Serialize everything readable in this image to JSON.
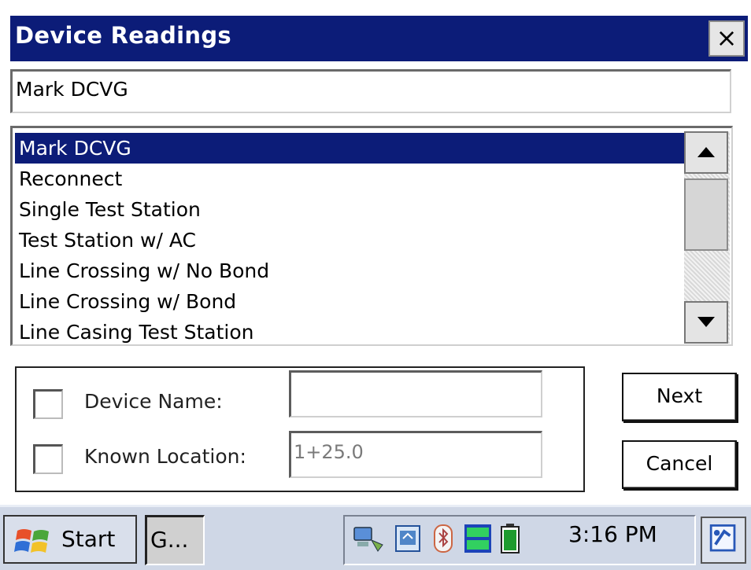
{
  "window": {
    "title": "Device Readings",
    "close_label": "×"
  },
  "combo": {
    "value": "Mark DCVG"
  },
  "list": {
    "items": [
      {
        "label": "Mark DCVG",
        "selected": true
      },
      {
        "label": "Reconnect"
      },
      {
        "label": "Single Test Station"
      },
      {
        "label": "Test Station w/ AC"
      },
      {
        "label": "Line Crossing w/ No Bond"
      },
      {
        "label": "Line Crossing w/ Bond"
      },
      {
        "label": "Line Casing Test Station"
      }
    ]
  },
  "options": {
    "device_name_label": "Device Name:",
    "device_name_value": "",
    "known_location_label": "Known Location:",
    "known_location_value": "1+25.0"
  },
  "buttons": {
    "next": "Next",
    "cancel": "Cancel"
  },
  "taskbar": {
    "start_label": "Start",
    "task_item": "G...",
    "tray_icons": [
      "network-icon",
      "sync-icon",
      "bluetooth-icon",
      "dtg-client-icon",
      "battery-icon"
    ],
    "time": "3:16 PM",
    "desktop_icon": "desktop-icon"
  },
  "colors": {
    "title_bar": "#0c1c78",
    "selection": "#0c1c78",
    "taskbar": "#cfd7e6"
  }
}
